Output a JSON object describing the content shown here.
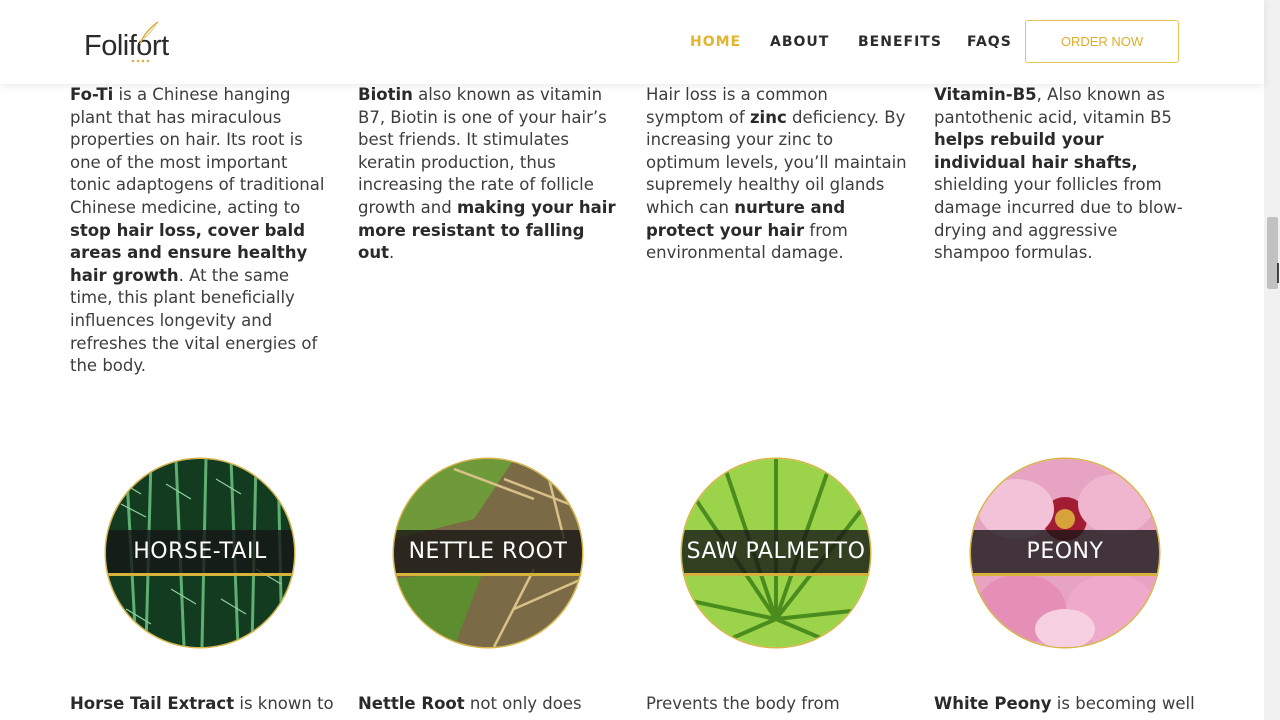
{
  "header": {
    "logo_text": "Folifort",
    "nav": [
      "HOME",
      "ABOUT",
      "BENEFITS",
      "FAQS"
    ],
    "order_button": "ORDER NOW",
    "accent_color": "#e3b42e"
  },
  "columns": [
    {
      "segments": [
        {
          "b": true,
          "t": "Fo-Ti"
        },
        {
          "b": false,
          "t": " is a Chinese hanging plant that has miraculous properties on hair. Its root is one of the most important tonic adaptogens of traditional Chinese medicine, acting to "
        },
        {
          "b": true,
          "t": "stop hair loss, cover bald areas and ensure healthy hair growth"
        },
        {
          "b": false,
          "t": ". At the same time, this plant beneficially influences longevity and refreshes the vital energies of the body."
        }
      ]
    },
    {
      "segments": [
        {
          "b": true,
          "t": "Biotin"
        },
        {
          "b": false,
          "t": " also known as vitamin B7, Biotin is one of your hair’s best friends. It stimulates keratin production, thus increasing the rate of follicle growth and "
        },
        {
          "b": true,
          "t": "making your hair more resistant to falling out"
        },
        {
          "b": false,
          "t": "."
        }
      ]
    },
    {
      "segments": [
        {
          "b": false,
          "t": "Hair loss is a common symptom of "
        },
        {
          "b": true,
          "t": "zinc"
        },
        {
          "b": false,
          "t": " deficiency. By increasing your zinc to optimum levels, you’ll maintain supremely healthy oil glands which can "
        },
        {
          "b": true,
          "t": "nurture and protect your hair"
        },
        {
          "b": false,
          "t": " from environmental damage."
        }
      ]
    },
    {
      "segments": [
        {
          "b": true,
          "t": "Vitamin-B5"
        },
        {
          "b": false,
          "t": ", Also known as pantothenic acid, vitamin B5 "
        },
        {
          "b": true,
          "t": "helps rebuild your individual hair shafts,"
        },
        {
          "b": false,
          "t": " shielding your follicles from damage incurred due to blow-drying and aggressive shampoo formulas."
        }
      ]
    }
  ],
  "ingredients": [
    {
      "name": "HORSE-TAIL",
      "icon": "horsetail-image"
    },
    {
      "name": "NETTLE ROOT",
      "icon": "nettle-root-image"
    },
    {
      "name": "SAW PALMETTO",
      "icon": "saw-palmetto-image"
    },
    {
      "name": "PEONY",
      "icon": "peony-image"
    }
  ],
  "bottom": [
    {
      "bold": "Horse Tail Extract",
      "rest": " is known to"
    },
    {
      "bold": "Nettle Root",
      "rest": " not only does"
    },
    {
      "bold": "",
      "rest": "Prevents the body from"
    },
    {
      "bold": "White Peony",
      "rest": " is becoming well"
    }
  ]
}
